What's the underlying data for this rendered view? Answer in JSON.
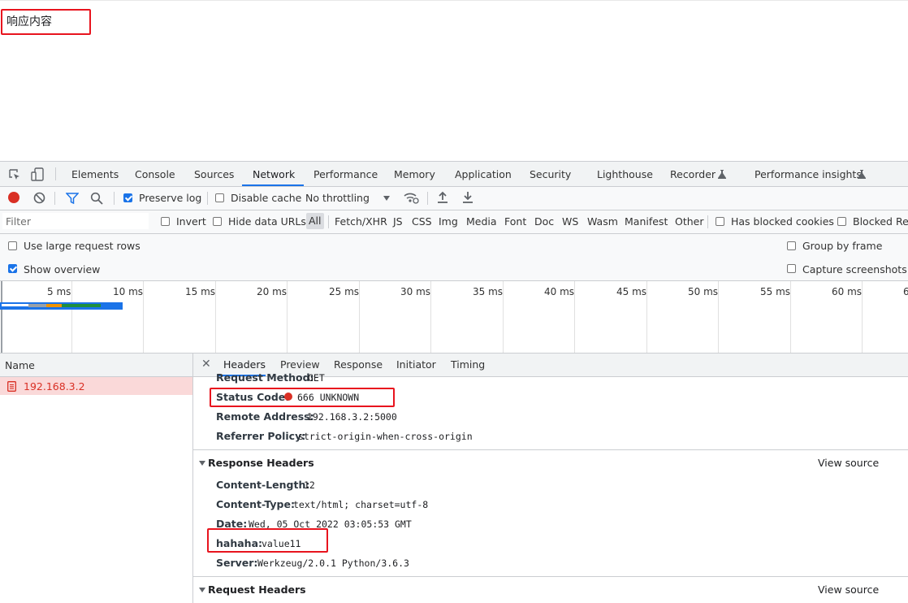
{
  "page": {
    "body_text": "响应内容"
  },
  "devtools": {
    "tabs": [
      "Elements",
      "Console",
      "Sources",
      "Network",
      "Performance",
      "Memory",
      "Application",
      "Security",
      "Lighthouse",
      "Recorder",
      "Performance insights"
    ],
    "active_tab": "Network",
    "toolbar": {
      "preserve_log": "Preserve log",
      "preserve_log_checked": true,
      "disable_cache": "Disable cache",
      "disable_cache_checked": false,
      "throttling": "No throttling"
    },
    "filter": {
      "placeholder": "Filter",
      "invert": "Invert",
      "hide_data_urls": "Hide data URLs",
      "types": [
        "All",
        "Fetch/XHR",
        "JS",
        "CSS",
        "Img",
        "Media",
        "Font",
        "Doc",
        "WS",
        "Wasm",
        "Manifest",
        "Other"
      ],
      "selected_type": "All",
      "has_blocked_cookies": "Has blocked cookies",
      "blocked_requests": "Blocked Req"
    },
    "options": {
      "large_rows": "Use large request rows",
      "large_rows_checked": false,
      "show_overview": "Show overview",
      "show_overview_checked": true,
      "group_by_frame": "Group by frame",
      "group_by_frame_checked": false,
      "capture_screenshots": "Capture screenshots",
      "capture_screenshots_checked": false
    },
    "overview": {
      "ticks": [
        "5 ms",
        "10 ms",
        "15 ms",
        "20 ms",
        "25 ms",
        "30 ms",
        "35 ms",
        "40 ms",
        "45 ms",
        "50 ms",
        "55 ms",
        "60 ms",
        "6"
      ]
    },
    "requests": {
      "column_name": "Name",
      "items": [
        {
          "name": "192.168.3.2",
          "status": "error"
        }
      ]
    },
    "detail": {
      "tabs": [
        "Headers",
        "Preview",
        "Response",
        "Initiator",
        "Timing"
      ],
      "active_tab": "Headers",
      "general": [
        {
          "name": "Request Method:",
          "value": "GET"
        },
        {
          "name": "Status Code:",
          "value": "666 UNKNOWN"
        },
        {
          "name": "Remote Address:",
          "value": "192.168.3.2:5000"
        },
        {
          "name": "Referrer Policy:",
          "value": "strict-origin-when-cross-origin"
        }
      ],
      "response_headers_title": "Response Headers",
      "view_source": "View source",
      "response_headers": [
        {
          "name": "Content-Length:",
          "value": "12"
        },
        {
          "name": "Content-Type:",
          "value": "text/html; charset=utf-8"
        },
        {
          "name": "Date:",
          "value": "Wed, 05 Oct 2022 03:05:53 GMT"
        },
        {
          "name": "hahaha:",
          "value": "value11"
        },
        {
          "name": "Server:",
          "value": "Werkzeug/2.0.1 Python/3.6.3"
        }
      ],
      "request_headers_title": "Request Headers"
    },
    "colors": {
      "accent": "#1a73e8",
      "error": "#d93025",
      "highlight": "#e8141e",
      "request_row_bg": "#fad9d9"
    }
  }
}
